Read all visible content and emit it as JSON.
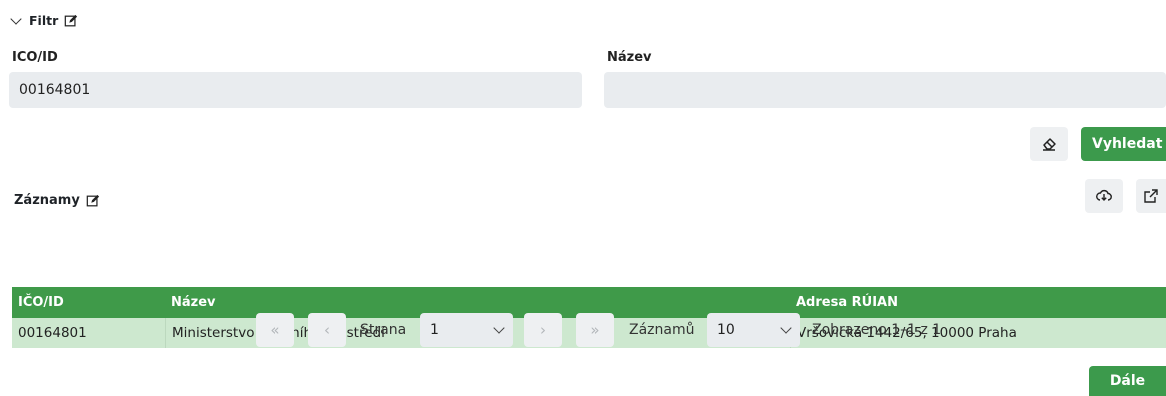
{
  "filter": {
    "title": "Filtr",
    "ico_label": "ICO/ID",
    "ico_value": "00164801",
    "name_label": "Název",
    "name_value": "",
    "search_label": "Vyhledat"
  },
  "records": {
    "title": "Záznamy",
    "columns": [
      "IČO/ID",
      "Název",
      "Adresa RÚIAN"
    ],
    "rows": [
      [
        "00164801",
        "Ministerstvo životního prostředí",
        "Vršovická 1442/65, 10000 Praha"
      ]
    ]
  },
  "pagination": {
    "first": "«",
    "prev": "‹",
    "next": "›",
    "last": "»",
    "page_label": "Strana",
    "page_value": "1",
    "per_page_label": "Záznamů",
    "per_page_value": "10",
    "status": "Zobrazeno 1–1 z 1"
  },
  "footer": {
    "next_label": "Dále"
  },
  "colors": {
    "accent": "#3c9a4c",
    "row_highlight": "#cde8cf",
    "field_bg": "#e9ecef"
  }
}
